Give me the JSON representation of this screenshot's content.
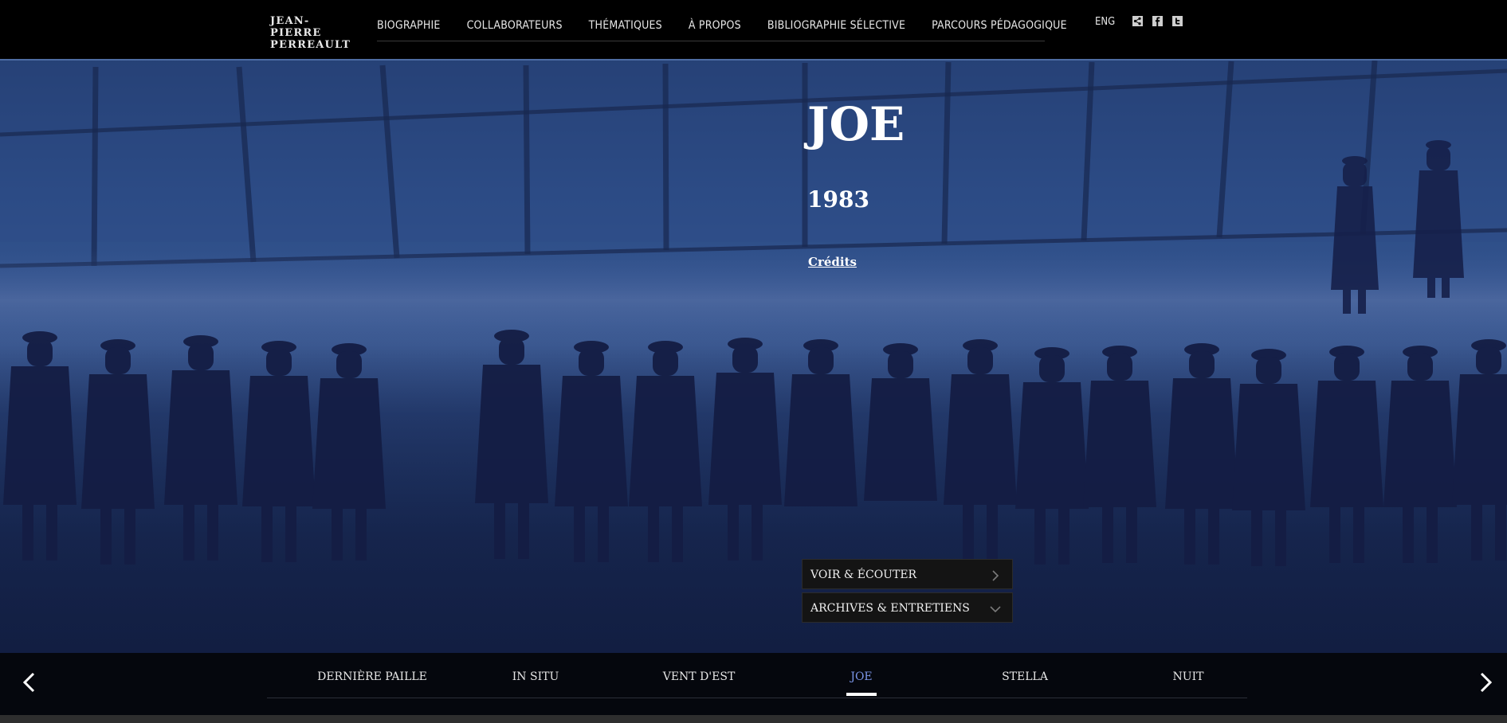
{
  "logo": {
    "line1": "JEAN-PIERRE",
    "line2": "PERREAULT"
  },
  "nav": {
    "items": [
      {
        "label": "BIOGRAPHIE"
      },
      {
        "label": "COLLABORATEURS"
      },
      {
        "label": "THÉMATIQUES"
      },
      {
        "label": "À PROPOS"
      },
      {
        "label": "BIBLIOGRAPHIE SÉLECTIVE"
      },
      {
        "label": "PARCOURS PÉDAGOGIQUE"
      }
    ],
    "lang": "ENG",
    "social_icons": [
      "share-icon",
      "facebook-icon",
      "twitter-icon"
    ]
  },
  "hero": {
    "title": "JOE",
    "year": "1983",
    "credits_link": "Crédits",
    "buttons": [
      {
        "label": "VOIR & ÉCOUTER",
        "icon": "chevron-right-icon"
      },
      {
        "label": "ARCHIVES & ENTRETIENS",
        "icon": "chevron-down-icon"
      }
    ]
  },
  "carousel": {
    "items": [
      {
        "label": "DERNIÈRE PAILLE"
      },
      {
        "label": "IN SITU"
      },
      {
        "label": "VENT D'EST"
      },
      {
        "label": "JOE"
      },
      {
        "label": "STELLA"
      },
      {
        "label": "NUIT"
      }
    ],
    "active": "JOE",
    "accent_color": "#7b95e8",
    "prev_icon": "chevron-left-icon",
    "next_icon": "chevron-right-icon"
  }
}
